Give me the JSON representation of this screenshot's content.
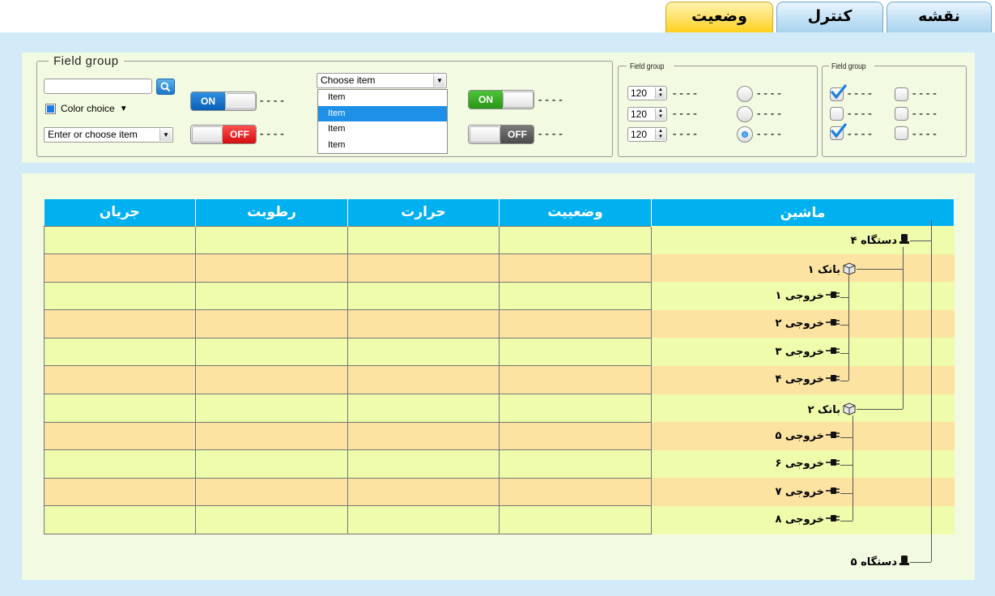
{
  "tabs": [
    {
      "label": "نقشه",
      "active": false
    },
    {
      "label": "کنترل",
      "active": false
    },
    {
      "label": "وضعیت",
      "active": true
    }
  ],
  "field_group_main": {
    "legend": "Field group",
    "color_choice_label": "Color choice",
    "combo_placeholder": "Enter or choose item",
    "toggle_on_label": "ON",
    "toggle_off_label": "OFF",
    "dash_label": "----",
    "choose_item": "Choose item",
    "dropdown_items": [
      "Item",
      "Item",
      "Item",
      "Item"
    ],
    "dropdown_selected_index": 1
  },
  "field_group_spin": {
    "legend": "Field group",
    "spinners": [
      "120",
      "120",
      "120"
    ],
    "radio_selected_index": 2
  },
  "field_group_check": {
    "legend": "Field group",
    "checkboxes_left": [
      true,
      false,
      true
    ],
    "checkboxes_right": [
      false,
      false,
      false
    ]
  },
  "table": {
    "headers": [
      "جریان",
      "رطوبت",
      "حرارت",
      "وضعییت",
      "ماشین"
    ],
    "tree": [
      {
        "label": "دستگاه ۴",
        "icon": "device-icon",
        "level": 0
      },
      {
        "label": "بانک ۱",
        "icon": "box-icon",
        "level": 1
      },
      {
        "label": "خروجی ۱",
        "icon": "plug-icon",
        "level": 2
      },
      {
        "label": "خروجی ۲",
        "icon": "plug-icon",
        "level": 2
      },
      {
        "label": "خروجی ۳",
        "icon": "plug-icon",
        "level": 2
      },
      {
        "label": "خروجی ۴",
        "icon": "plug-icon",
        "level": 2
      },
      {
        "label": "بانک ۲",
        "icon": "box-icon",
        "level": 1
      },
      {
        "label": "خروجی ۵",
        "icon": "plug-icon",
        "level": 2
      },
      {
        "label": "خروجی ۶",
        "icon": "plug-icon",
        "level": 2
      },
      {
        "label": "خروجی ۷",
        "icon": "plug-icon",
        "level": 2
      },
      {
        "label": "خروجی ۸",
        "icon": "plug-icon",
        "level": 2
      }
    ],
    "extra_node": {
      "label": "دستگاه ۵",
      "icon": "device-icon"
    }
  },
  "colors": {
    "header": "#00b0ef",
    "row_light": "#eefcab",
    "row_dark": "#fde3a2",
    "panel": "#f2fbe2",
    "background": "#d3ebf9",
    "active_tab": "#ffd21c"
  }
}
